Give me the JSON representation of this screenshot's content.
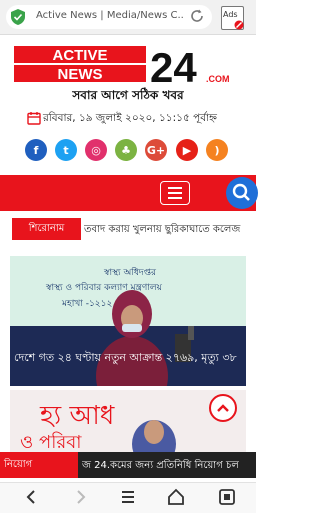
{
  "browser": {
    "url_text": "Active News | Media/News C...",
    "ads_label": "Ads"
  },
  "logo": {
    "line1": "ACTIVE",
    "line2": "NEWS",
    "number": "24",
    "dotcom": ".COM",
    "tagline": "সবার আগে সঠিক খবর"
  },
  "date_text": "রবিবার, ১৯ জুলাই ২০২০, ১১:১৫ পূর্বাহ্ন",
  "social": [
    {
      "icon": "facebook-icon",
      "glyph": "f",
      "color": "#1f5fbf"
    },
    {
      "icon": "twitter-icon",
      "glyph": "t",
      "color": "#1da1f2"
    },
    {
      "icon": "instagram-icon",
      "glyph": "◎",
      "color": "#e1306c"
    },
    {
      "icon": "android-icon",
      "glyph": "♣",
      "color": "#7cb342"
    },
    {
      "icon": "google-plus-icon",
      "glyph": "G+",
      "color": "#dd4b39"
    },
    {
      "icon": "youtube-icon",
      "glyph": "▶",
      "color": "#e62117"
    },
    {
      "icon": "rss-icon",
      "glyph": ")",
      "color": "#f58220"
    }
  ],
  "ticker": {
    "label": "শিরোনাম",
    "text": "তবাদ করায় খুলনায় ছুরিকাঘাতে কলেজ"
  },
  "card1": {
    "banner_line1": "স্বাস্থ্য অধিদপ্তর",
    "banner_line2": "স্বাস্থ্য ও পরিবার কল্যাণ মন্ত্রণালয়",
    "banner_line3": "মহাখা                           -১২১২",
    "caption": "দেশে গত ২৪ ঘণ্টায় নতুন আক্রান্ত ২৭৬৯, মৃত্যু ৩৮"
  },
  "bottom_ticker": {
    "label": "নিয়োগ",
    "text": "জ 24.কমের জন্য প্রতিনিধি নিয়োগ চল"
  }
}
